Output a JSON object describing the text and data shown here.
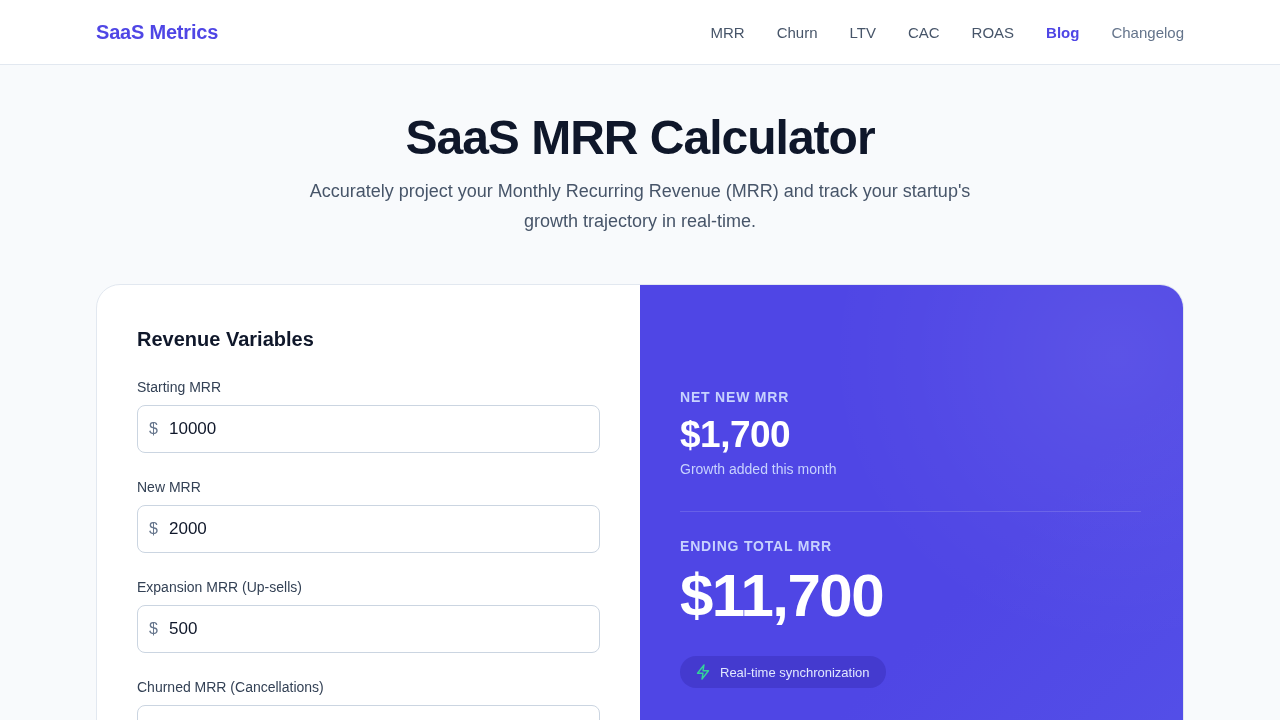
{
  "header": {
    "logo": "SaaS Metrics",
    "nav": [
      {
        "label": "MRR",
        "selected": false,
        "kind": "page"
      },
      {
        "label": "Churn",
        "selected": false,
        "kind": "page"
      },
      {
        "label": "LTV",
        "selected": false,
        "kind": "page"
      },
      {
        "label": "CAC",
        "selected": false,
        "kind": "page"
      },
      {
        "label": "ROAS",
        "selected": false,
        "kind": "page"
      },
      {
        "label": "Blog",
        "selected": true,
        "kind": "page"
      },
      {
        "label": "Changelog",
        "selected": false,
        "kind": "secondary"
      }
    ]
  },
  "hero": {
    "title": "SaaS MRR Calculator",
    "subtitle": "Accurately project your Monthly Recurring Revenue (MRR) and track your startup's growth trajectory in real-time."
  },
  "inputs": {
    "title": "Revenue Variables",
    "fields": [
      {
        "label": "Starting MRR",
        "prefix": "$",
        "value": "10000"
      },
      {
        "label": "New MRR",
        "prefix": "$",
        "value": "2000"
      },
      {
        "label": "Expansion MRR (Up-sells)",
        "prefix": "$",
        "value": "500"
      },
      {
        "label": "Churned MRR (Cancellations)"
      }
    ]
  },
  "results": {
    "net_new": {
      "label": "NET NEW MRR",
      "value": "$1,700",
      "caption": "Growth added this month"
    },
    "ending_total": {
      "label": "ENDING TOTAL MRR",
      "value": "$11,700"
    },
    "badge": {
      "text": "Real-time synchronization"
    }
  }
}
